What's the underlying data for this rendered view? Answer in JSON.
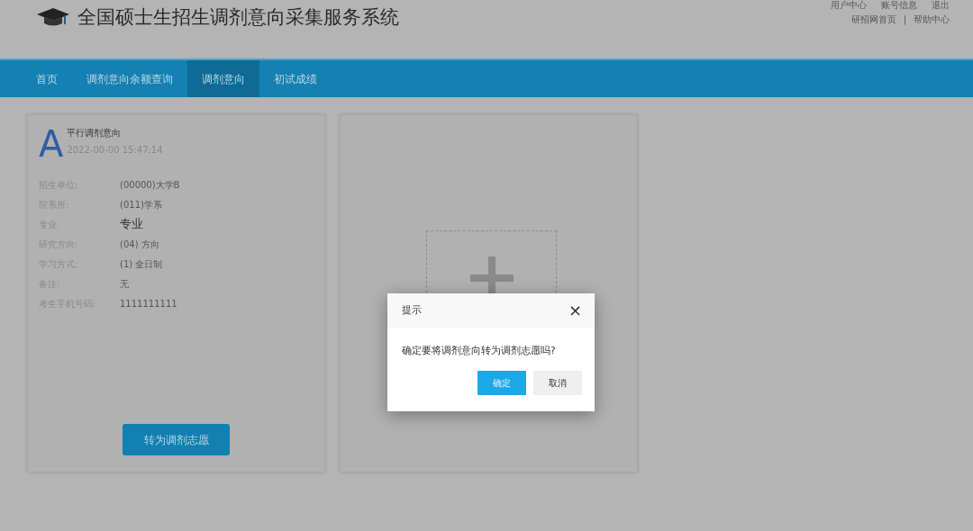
{
  "header": {
    "title": "全国硕士生招生调剂意向采集服务系统",
    "user_links": [
      "用户中心",
      "账号信息",
      "退出"
    ],
    "site_links": [
      "研招网首页",
      "帮助中心"
    ],
    "separator": "|"
  },
  "nav": [
    {
      "label": "首页",
      "selected": false
    },
    {
      "label": "调剂意向余额查询",
      "selected": false
    },
    {
      "label": "调剂意向",
      "selected": true
    },
    {
      "label": "初试成绩",
      "selected": false
    }
  ],
  "intent_card": {
    "letter": "A",
    "title": "平行调剂意向",
    "time": "2022-00-00 15:47:14",
    "fields": [
      {
        "label": "招生单位:",
        "value": "(00000)大学B",
        "emphasis": false
      },
      {
        "label": "院系所:",
        "value": "(011)学系",
        "emphasis": false
      },
      {
        "label": "专业:",
        "value": "专业",
        "emphasis": true
      },
      {
        "label": "研究方向:",
        "value": "(04) 方向",
        "emphasis": false
      },
      {
        "label": "学习方式:",
        "value": "(1) 全日制",
        "emphasis": false
      },
      {
        "label": "备注:",
        "value": "无",
        "emphasis": false
      },
      {
        "label": "考生手机号码:",
        "value": "1111111111",
        "emphasis": false
      }
    ],
    "button": "转为调剂志愿"
  },
  "dialog": {
    "title": "提示",
    "close": "×",
    "message": "确定要将调剂意向转为调剂志愿吗?",
    "buttons": [
      {
        "label": "确定",
        "kind": "primary"
      },
      {
        "label": "取消",
        "kind": "secondary"
      }
    ]
  }
}
